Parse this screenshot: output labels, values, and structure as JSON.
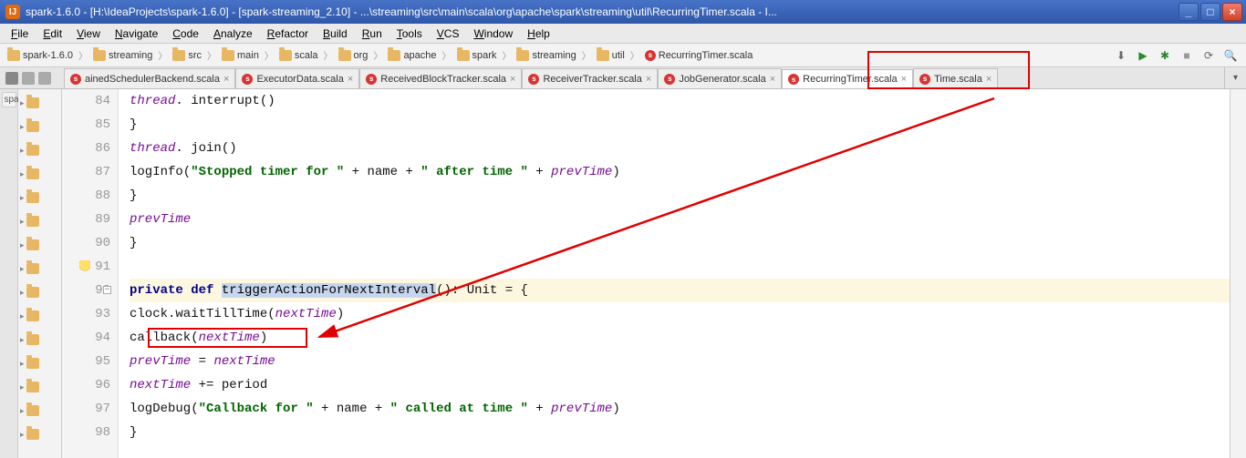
{
  "title": "spark-1.6.0 - [H:\\IdeaProjects\\spark-1.6.0] - [spark-streaming_2.10] - ...\\streaming\\src\\main\\scala\\org\\apache\\spark\\streaming\\util\\RecurringTimer.scala - I...",
  "menu": [
    "File",
    "Edit",
    "View",
    "Navigate",
    "Code",
    "Analyze",
    "Refactor",
    "Build",
    "Run",
    "Tools",
    "VCS",
    "Window",
    "Help"
  ],
  "breadcrumbs": [
    {
      "type": "folder",
      "label": "spark-1.6.0"
    },
    {
      "type": "folder",
      "label": "streaming"
    },
    {
      "type": "folder",
      "label": "src"
    },
    {
      "type": "folder",
      "label": "main"
    },
    {
      "type": "folder",
      "label": "scala"
    },
    {
      "type": "folder",
      "label": "org"
    },
    {
      "type": "folder",
      "label": "apache"
    },
    {
      "type": "folder",
      "label": "spark"
    },
    {
      "type": "folder",
      "label": "streaming"
    },
    {
      "type": "folder",
      "label": "util"
    },
    {
      "type": "scala",
      "label": "RecurringTimer.scala"
    }
  ],
  "tabs": [
    {
      "label": "ainedSchedulerBackend.scala",
      "active": false
    },
    {
      "label": "ExecutorData.scala",
      "active": false
    },
    {
      "label": "ReceivedBlockTracker.scala",
      "active": false
    },
    {
      "label": "ReceiverTracker.scala",
      "active": false
    },
    {
      "label": "JobGenerator.scala",
      "active": false
    },
    {
      "label": "RecurringTimer.scala",
      "active": true
    },
    {
      "label": "Time.scala",
      "active": false
    }
  ],
  "side_label": "spa",
  "gutter_start": 84,
  "code": {
    "l84": {
      "indent": "          ",
      "a": "thread",
      "b": ". interrupt()"
    },
    "l85": {
      "indent": "        ",
      "a": "}"
    },
    "l86": {
      "indent": "        ",
      "a": "thread",
      "b": ". join()"
    },
    "l87": {
      "indent": "        ",
      "a": "logInfo(",
      "s1": "\"Stopped timer for \"",
      "b": " + name + ",
      "s2": "\" after time \"",
      "c": " + ",
      "d": "prevTime",
      "e": ")"
    },
    "l88": {
      "indent": "      ",
      "a": "}"
    },
    "l89": {
      "indent": "      ",
      "a": "prevTime"
    },
    "l90": {
      "indent": "    ",
      "a": "}"
    },
    "l91": {
      "indent": ""
    },
    "l92": {
      "indent": "    ",
      "kw1": "private",
      "sp1": " ",
      "kw2": "def",
      "sp2": " ",
      "sel": "triggerActionForNextInterval",
      "rest": "(): Unit = {"
    },
    "l93": {
      "indent": "      ",
      "a": "clock.waitTillTime(",
      "b": "nextTime",
      "c": ")"
    },
    "l94": {
      "indent": "      ",
      "a": "callback(",
      "b": "nextTime",
      "c": ")"
    },
    "l95": {
      "indent": "      ",
      "a": "prevTime",
      "b": " = ",
      "c": "nextTime"
    },
    "l96": {
      "indent": "      ",
      "a": "nextTime",
      "b": " += period"
    },
    "l97": {
      "indent": "      ",
      "a": "logDebug(",
      "s1": "\"Callback for \"",
      "b": " + name + ",
      "s2": "\" called at time \"",
      "c": " + ",
      "d": "prevTime",
      "e": ")"
    },
    "l98": {
      "indent": "    ",
      "a": "}"
    }
  }
}
